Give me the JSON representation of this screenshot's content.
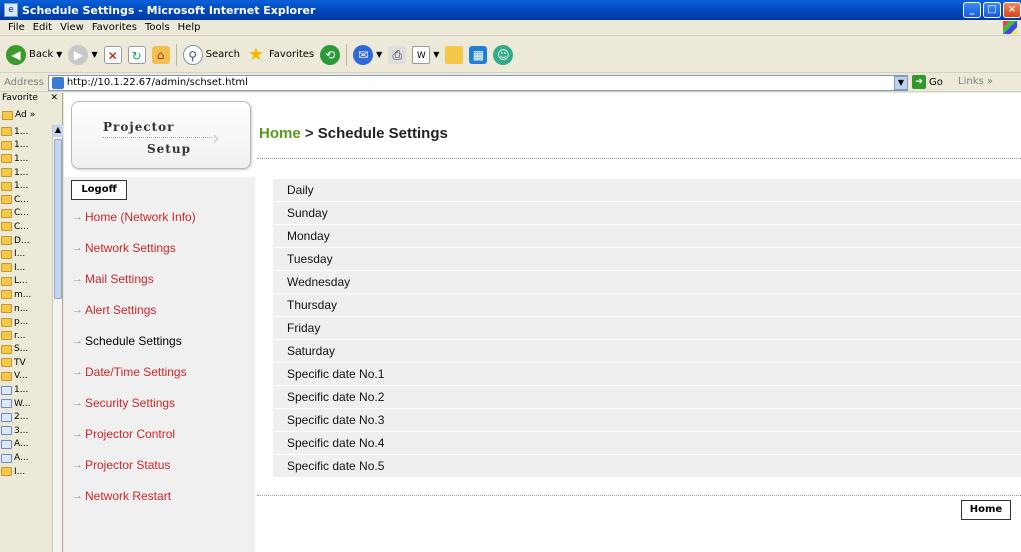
{
  "window": {
    "title": "Schedule Settings - Microsoft Internet Explorer"
  },
  "menu": [
    "File",
    "Edit",
    "View",
    "Favorites",
    "Tools",
    "Help"
  ],
  "toolbar": {
    "back_label": "Back",
    "search_label": "Search",
    "favorites_label": "Favorites"
  },
  "address": {
    "label": "Address",
    "url": "http://10.1.22.67/admin/schset.html",
    "go_label": "Go",
    "links_label": "Links"
  },
  "favorites_pane": {
    "title": "Favorite",
    "add_label": "Ad",
    "items": [
      {
        "label": "1...",
        "icon": "folder-icon"
      },
      {
        "label": "1...",
        "icon": "folder-icon"
      },
      {
        "label": "1...",
        "icon": "folder-icon"
      },
      {
        "label": "1...",
        "icon": "folder-icon"
      },
      {
        "label": "1...",
        "icon": "folder-icon"
      },
      {
        "label": "C...",
        "icon": "folder-icon"
      },
      {
        "label": "C...",
        "icon": "folder-icon"
      },
      {
        "label": "C...",
        "icon": "folder-icon"
      },
      {
        "label": "D...",
        "icon": "folder-icon"
      },
      {
        "label": "I...",
        "icon": "folder-icon"
      },
      {
        "label": "I...",
        "icon": "folder-icon"
      },
      {
        "label": "L...",
        "icon": "folder-icon"
      },
      {
        "label": "m...",
        "icon": "folder-icon"
      },
      {
        "label": "n...",
        "icon": "folder-icon"
      },
      {
        "label": "p...",
        "icon": "folder-icon"
      },
      {
        "label": "r...",
        "icon": "folder-icon"
      },
      {
        "label": "S...",
        "icon": "folder-icon"
      },
      {
        "label": "TV",
        "icon": "folder-icon"
      },
      {
        "label": "V...",
        "icon": "folder-icon"
      },
      {
        "label": "1...",
        "icon": "page-icon"
      },
      {
        "label": "W...",
        "icon": "page-icon"
      },
      {
        "label": "2...",
        "icon": "page-icon"
      },
      {
        "label": "3...",
        "icon": "page-icon"
      },
      {
        "label": "A...",
        "icon": "page-icon"
      },
      {
        "label": "A...",
        "icon": "page-icon"
      },
      {
        "label": "I...",
        "icon": "folder-icon"
      }
    ]
  },
  "logo": {
    "line1": "Projector",
    "line2": "Setup"
  },
  "logoff_label": "Logoff",
  "nav": [
    {
      "label": "Home (Network Info)",
      "active": false
    },
    {
      "label": "Network Settings",
      "active": false
    },
    {
      "label": "Mail Settings",
      "active": false
    },
    {
      "label": "Alert Settings",
      "active": false
    },
    {
      "label": "Schedule Settings",
      "active": true
    },
    {
      "label": "Date/Time Settings",
      "active": false
    },
    {
      "label": "Security Settings",
      "active": false
    },
    {
      "label": "Projector Control",
      "active": false
    },
    {
      "label": "Projector Status",
      "active": false
    },
    {
      "label": "Network Restart",
      "active": false
    }
  ],
  "breadcrumb": {
    "home": "Home",
    "separator": ">",
    "current": "Schedule Settings"
  },
  "schedule_items": [
    "Daily",
    "Sunday",
    "Monday",
    "Tuesday",
    "Wednesday",
    "Thursday",
    "Friday",
    "Saturday",
    "Specific date No.1",
    "Specific date No.2",
    "Specific date No.3",
    "Specific date No.4",
    "Specific date No.5"
  ],
  "home_button_label": "Home",
  "colors": {
    "nav_link": "#c8282c",
    "breadcrumb_home": "#5a9a20",
    "row_bg": "#efefef"
  }
}
